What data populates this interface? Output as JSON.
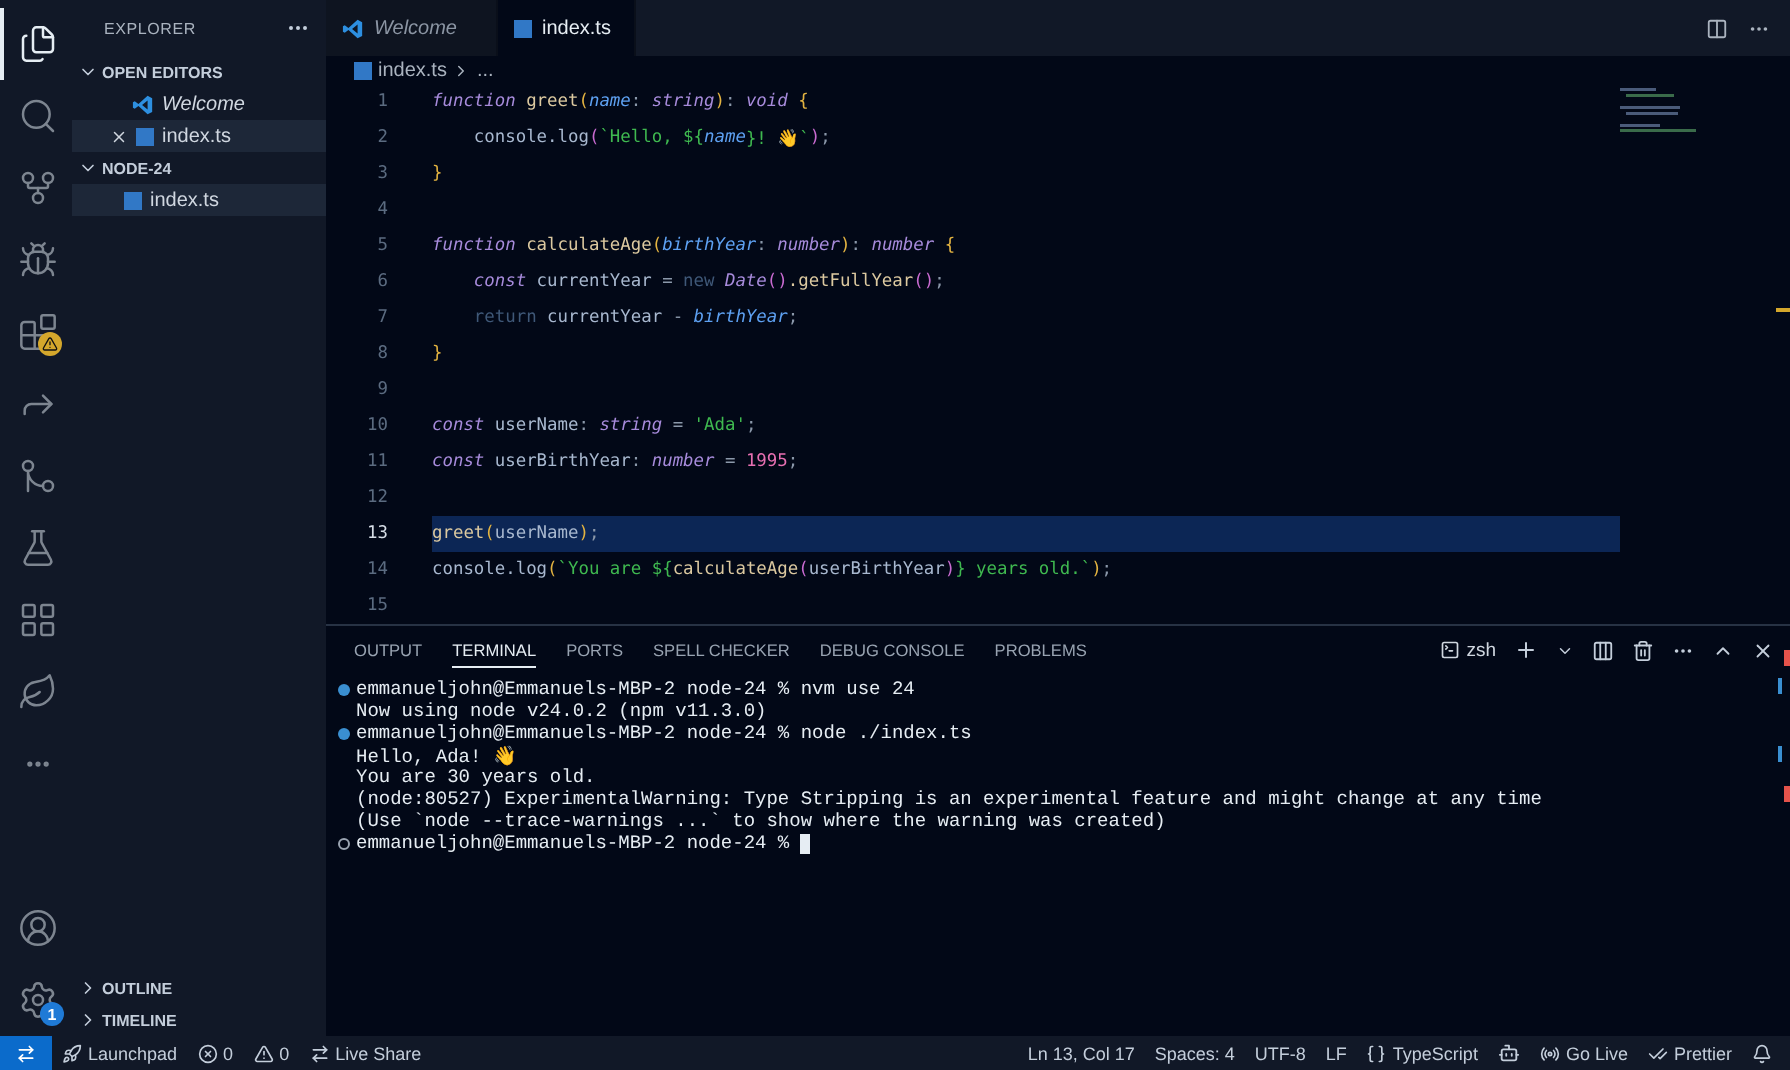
{
  "activity_bar": {
    "items": [
      {
        "kind": "explorer",
        "selected": true,
        "warning": false
      },
      {
        "kind": "search",
        "selected": false,
        "warning": false
      },
      {
        "kind": "source-control",
        "selected": false,
        "warning": false
      },
      {
        "kind": "debug",
        "selected": false,
        "warning": false
      },
      {
        "kind": "extensions",
        "selected": false,
        "warning": true
      },
      {
        "kind": "remote",
        "selected": false,
        "warning": false
      },
      {
        "kind": "git",
        "selected": false,
        "warning": false
      },
      {
        "kind": "testing",
        "selected": false,
        "warning": false
      },
      {
        "kind": "containers",
        "selected": false,
        "warning": false
      },
      {
        "kind": "database",
        "selected": false,
        "warning": false
      },
      {
        "kind": "more",
        "selected": false,
        "warning": false
      }
    ],
    "settings_badge": "1"
  },
  "sidebar": {
    "title": "EXPLORER",
    "sections": [
      {
        "title": "OPEN EDITORS",
        "expanded": true,
        "items": [
          {
            "name": "Welcome",
            "kind": "vscode",
            "preview": true,
            "selected": false,
            "closable": false
          },
          {
            "name": "index.ts",
            "kind": "ts",
            "preview": false,
            "selected": true,
            "closable": true
          }
        ]
      },
      {
        "title": "NODE-24",
        "expanded": true,
        "items": [
          {
            "name": "index.ts",
            "kind": "ts",
            "preview": false,
            "selected": true,
            "closable": false
          }
        ]
      }
    ],
    "bottom_sections": [
      {
        "title": "OUTLINE",
        "expanded": false
      },
      {
        "title": "TIMELINE",
        "expanded": false
      }
    ]
  },
  "editor": {
    "tabs": [
      {
        "label": "Welcome",
        "kind": "vscode",
        "preview": true,
        "selected": false
      },
      {
        "label": "index.ts",
        "kind": "ts",
        "preview": false,
        "selected": true
      }
    ],
    "breadcrumb": [
      "index.ts",
      "..."
    ],
    "lines": [
      {
        "number": "1",
        "current": false,
        "tokens": [
          {
            "kind": "kw",
            "t": "function "
          },
          {
            "kind": "fn",
            "t": "greet"
          },
          {
            "kind": "brace",
            "t": "("
          },
          {
            "kind": "param",
            "t": "name"
          },
          {
            "kind": "punc",
            "t": ": "
          },
          {
            "kind": "type",
            "t": "string"
          },
          {
            "kind": "brace",
            "t": ")"
          },
          {
            "kind": "punc",
            "t": ": "
          },
          {
            "kind": "type",
            "t": "void "
          },
          {
            "kind": "brace",
            "t": "{"
          }
        ]
      },
      {
        "number": "2",
        "current": false,
        "tokens": [
          {
            "kind": "plain",
            "t": "    console.log"
          },
          {
            "kind": "brace2",
            "t": "("
          },
          {
            "kind": "str",
            "t": "`Hello, ${"
          },
          {
            "kind": "param",
            "t": "name"
          },
          {
            "kind": "str",
            "t": "}! 👋`"
          },
          {
            "kind": "brace2",
            "t": ")"
          },
          {
            "kind": "punc",
            "t": ";"
          }
        ]
      },
      {
        "number": "3",
        "current": false,
        "tokens": [
          {
            "kind": "brace",
            "t": "}"
          }
        ]
      },
      {
        "number": "4",
        "current": false
      },
      {
        "number": "5",
        "current": false,
        "tokens": [
          {
            "kind": "kw",
            "t": "function "
          },
          {
            "kind": "fn",
            "t": "calculateAge"
          },
          {
            "kind": "brace",
            "t": "("
          },
          {
            "kind": "param",
            "t": "birthYear"
          },
          {
            "kind": "punc",
            "t": ": "
          },
          {
            "kind": "type",
            "t": "number"
          },
          {
            "kind": "brace",
            "t": ")"
          },
          {
            "kind": "punc",
            "t": ": "
          },
          {
            "kind": "type",
            "t": "number "
          },
          {
            "kind": "brace",
            "t": "{"
          }
        ]
      },
      {
        "number": "6",
        "current": false,
        "tokens": [
          {
            "kind": "kw",
            "t": "    const"
          },
          {
            "kind": "plain",
            "t": " currentYear "
          },
          {
            "kind": "punc",
            "t": "= "
          },
          {
            "kind": "dim",
            "t": "new "
          },
          {
            "kind": "type",
            "t": "Date"
          },
          {
            "kind": "brace2",
            "t": "()"
          },
          {
            "kind": "fn",
            "t": ".getFullYear"
          },
          {
            "kind": "brace2",
            "t": "()"
          },
          {
            "kind": "punc",
            "t": ";"
          }
        ]
      },
      {
        "number": "7",
        "current": false,
        "tokens": [
          {
            "kind": "dim",
            "t": "    return "
          },
          {
            "kind": "plain",
            "t": "currentYear "
          },
          {
            "kind": "punc",
            "t": "- "
          },
          {
            "kind": "param",
            "t": "birthYear"
          },
          {
            "kind": "punc",
            "t": ";"
          }
        ]
      },
      {
        "number": "8",
        "current": false,
        "tokens": [
          {
            "kind": "brace",
            "t": "}"
          }
        ]
      },
      {
        "number": "9",
        "current": false
      },
      {
        "number": "10",
        "current": false,
        "tokens": [
          {
            "kind": "kw",
            "t": "const"
          },
          {
            "kind": "plain",
            "t": " userName"
          },
          {
            "kind": "punc",
            "t": ": "
          },
          {
            "kind": "type",
            "t": "string"
          },
          {
            "kind": "punc",
            "t": " = "
          },
          {
            "kind": "str",
            "t": "'Ada'"
          },
          {
            "kind": "punc",
            "t": ";"
          }
        ]
      },
      {
        "number": "11",
        "current": false,
        "tokens": [
          {
            "kind": "kw",
            "t": "const"
          },
          {
            "kind": "plain",
            "t": " userBirthYear"
          },
          {
            "kind": "punc",
            "t": ": "
          },
          {
            "kind": "type",
            "t": "number"
          },
          {
            "kind": "punc",
            "t": " = "
          },
          {
            "kind": "num",
            "t": "1995"
          },
          {
            "kind": "punc",
            "t": ";"
          }
        ]
      },
      {
        "number": "12",
        "current": false
      },
      {
        "number": "13",
        "current": true,
        "tokens": [
          {
            "kind": "fn",
            "t": "greet"
          },
          {
            "kind": "brace",
            "t": "("
          },
          {
            "kind": "plain",
            "t": "userName"
          },
          {
            "kind": "brace",
            "t": ")"
          },
          {
            "kind": "punc",
            "t": ";"
          }
        ]
      },
      {
        "number": "14",
        "current": false,
        "tokens": [
          {
            "kind": "plain",
            "t": "console.log"
          },
          {
            "kind": "brace",
            "t": "("
          },
          {
            "kind": "str",
            "t": "`You are ${"
          },
          {
            "kind": "fn",
            "t": "calculateAge"
          },
          {
            "kind": "brace2",
            "t": "("
          },
          {
            "kind": "plain",
            "t": "userBirthYear"
          },
          {
            "kind": "brace2",
            "t": ")"
          },
          {
            "kind": "str",
            "t": "} years old.`"
          },
          {
            "kind": "brace",
            "t": ")"
          },
          {
            "kind": "punc",
            "t": ";"
          }
        ]
      },
      {
        "number": "15",
        "current": false
      }
    ]
  },
  "panel": {
    "tabs": [
      {
        "label": "OUTPUT",
        "selected": false
      },
      {
        "label": "TERMINAL",
        "selected": true
      },
      {
        "label": "PORTS",
        "selected": false
      },
      {
        "label": "SPELL CHECKER",
        "selected": false
      },
      {
        "label": "DEBUG CONSOLE",
        "selected": false
      },
      {
        "label": "PROBLEMS",
        "selected": false
      }
    ],
    "shell": "zsh",
    "terminal": [
      {
        "kind": "prompt",
        "done": true,
        "cursor": false,
        "text": "emmanueljohn@Emmanuels-MBP-2 node-24 % nvm use 24"
      },
      {
        "kind": "output",
        "cursor": false,
        "text": "Now using node v24.0.2 (npm v11.3.0)"
      },
      {
        "kind": "prompt",
        "done": true,
        "cursor": false,
        "text": "emmanueljohn@Emmanuels-MBP-2 node-24 % node ./index.ts"
      },
      {
        "kind": "output",
        "cursor": false,
        "text": "Hello, Ada! 👋"
      },
      {
        "kind": "output",
        "cursor": false,
        "text": "You are 30 years old."
      },
      {
        "kind": "output",
        "cursor": false,
        "text": "(node:80527) ExperimentalWarning: Type Stripping is an experimental feature and might change at any time"
      },
      {
        "kind": "output",
        "cursor": false,
        "text": "(Use `node --trace-warnings ...` to show where the warning was created)"
      },
      {
        "kind": "prompt",
        "done": false,
        "cursor": true,
        "text": "emmanueljohn@Emmanuels-MBP-2 node-24 %"
      }
    ]
  },
  "status_bar": {
    "left": [
      {
        "kind": "launchpad",
        "text": "Launchpad"
      },
      {
        "kind": "errors",
        "text": "0"
      },
      {
        "kind": "warnings",
        "text": "0"
      },
      {
        "kind": "liveshare",
        "text": "Live Share"
      }
    ],
    "right": [
      {
        "kind": "plain",
        "text": "Ln 13, Col 17"
      },
      {
        "kind": "plain",
        "text": "Spaces: 4"
      },
      {
        "kind": "plain",
        "text": "UTF-8"
      },
      {
        "kind": "plain",
        "text": "LF"
      },
      {
        "kind": "language",
        "text": "TypeScript"
      },
      {
        "kind": "copilot"
      },
      {
        "kind": "golive",
        "text": "Go Live"
      },
      {
        "kind": "prettier",
        "text": "Prettier"
      },
      {
        "kind": "bell"
      }
    ]
  }
}
